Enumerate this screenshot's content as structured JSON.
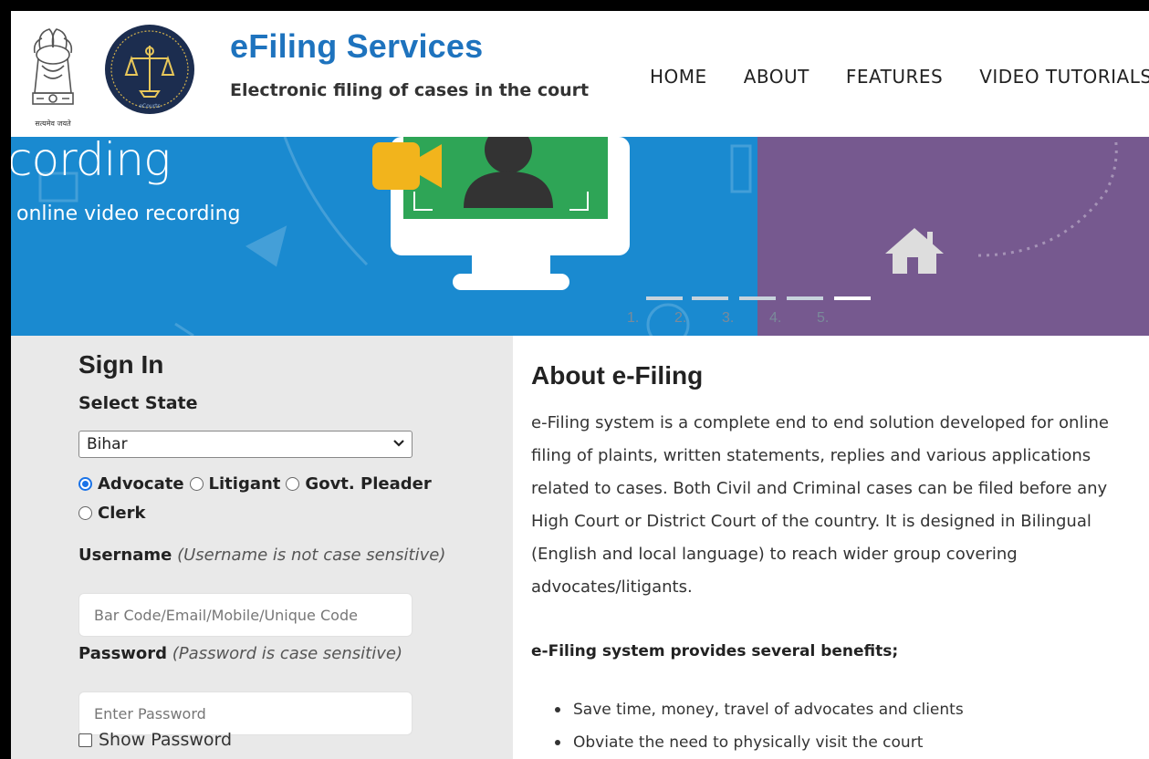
{
  "header": {
    "emblem_caption": "सत्यमेव जयते",
    "brand_title": "eFiling Services",
    "brand_tagline": "Electronic filing of cases in the court",
    "nav": [
      "HOME",
      "ABOUT",
      "FEATURES",
      "VIDEO TUTORIALS"
    ]
  },
  "banner": {
    "heading": "cording",
    "subheading": "online video recording",
    "slide_indicators": [
      "1.",
      "2.",
      "3.",
      "4.",
      "5."
    ],
    "active_slide": 5,
    "colors": {
      "left": "#1a8ad0",
      "right": "#76598f"
    }
  },
  "signin": {
    "title": "Sign In",
    "state_label": "Select State",
    "state_value": "Bihar",
    "roles": [
      {
        "label": "Advocate",
        "selected": true
      },
      {
        "label": "Litigant",
        "selected": false
      },
      {
        "label": "Govt. Pleader",
        "selected": false
      },
      {
        "label": "Clerk",
        "selected": false
      }
    ],
    "username_label": "Username",
    "username_hint": "(Username is not case sensitive)",
    "username_placeholder": "Bar Code/Email/Mobile/Unique Code",
    "password_label": "Password",
    "password_hint": "(Password is case sensitive)",
    "password_placeholder": "Enter Password",
    "show_password_label": "Show Password"
  },
  "about": {
    "title": "About e-Filing",
    "text": "e-Filing system is a complete end to end solution developed for online filing of plaints, written statements, replies and various applications related to cases. Both Civil and Criminal cases can be filed before any High Court or District Court of the country. It is designed in Bilingual (English and local language) to reach wider group covering advocates/litigants.",
    "benefits_title": "e-Filing system provides several benefits;",
    "benefits": [
      "Save time, money, travel of advocates and clients",
      "Obviate the need to physically visit the court"
    ]
  }
}
